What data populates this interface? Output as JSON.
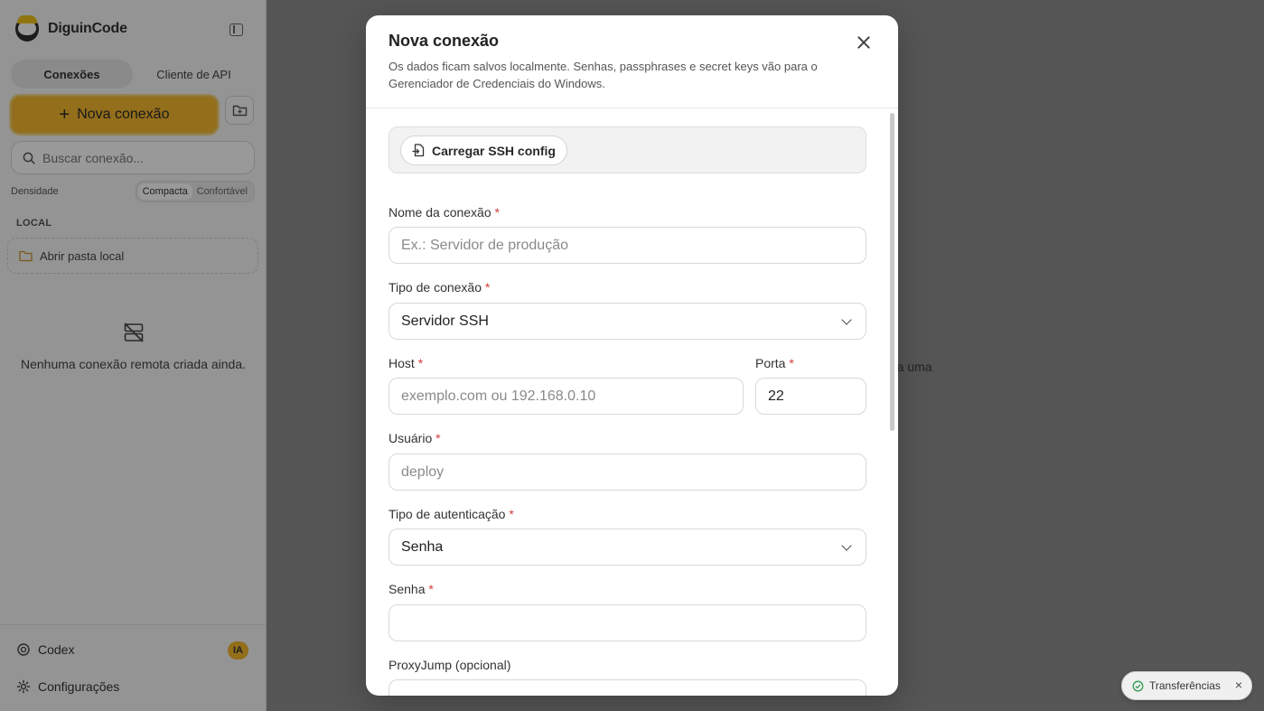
{
  "sidebar": {
    "brand": "DiguinCode",
    "tabs": [
      {
        "label": "Conexões",
        "active": true
      },
      {
        "label": "Cliente de API",
        "active": false
      }
    ],
    "new_connection_label": "Nova conexão",
    "search_placeholder": "Buscar conexão...",
    "density": {
      "label": "Densidade",
      "options": [
        "Compacta",
        "Confortável"
      ],
      "selected": "Compacta"
    },
    "local_section": "LOCAL",
    "open_local_folder": "Abrir pasta local",
    "empty_text": "Nenhuma conexão remota criada ainda.",
    "footer": {
      "codex": "Codex",
      "ia_badge": "IA",
      "settings": "Configurações"
    }
  },
  "main": {
    "peek_text": "ra uma"
  },
  "modal": {
    "title": "Nova conexão",
    "subtitle": "Os dados ficam salvos localmente. Senhas, passphrases e secret keys vão para o Gerenciador de Credenciais do Windows.",
    "load_ssh_config": "Carregar SSH config",
    "fields": {
      "name": {
        "label": "Nome da conexão",
        "required": "*",
        "placeholder": "Ex.: Servidor de produção",
        "value": ""
      },
      "type": {
        "label": "Tipo de conexão",
        "required": "*",
        "value": "Servidor SSH"
      },
      "host": {
        "label": "Host",
        "required": "*",
        "placeholder": "exemplo.com ou 192.168.0.10",
        "value": ""
      },
      "port": {
        "label": "Porta",
        "required": "*",
        "value": "22"
      },
      "user": {
        "label": "Usuário",
        "required": "*",
        "placeholder": "deploy",
        "value": ""
      },
      "auth": {
        "label": "Tipo de autenticação",
        "required": "*",
        "value": "Senha"
      },
      "password": {
        "label": "Senha",
        "required": "*",
        "value": ""
      },
      "proxyjump": {
        "label": "ProxyJump (opcional)",
        "value": ""
      }
    }
  },
  "transfers": {
    "label": "Transferências"
  },
  "colors": {
    "accent": "#f5b82e",
    "required": "#d23b3b"
  }
}
